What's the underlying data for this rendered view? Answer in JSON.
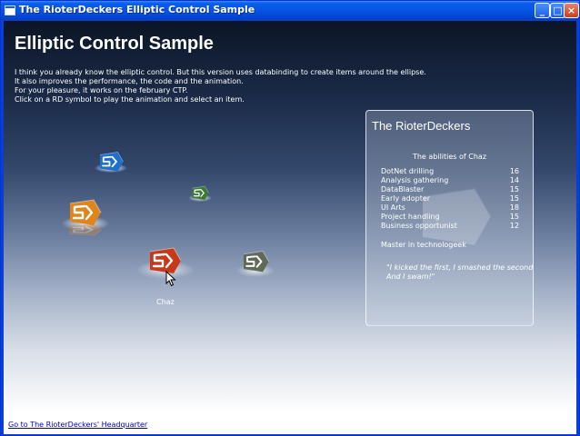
{
  "window": {
    "title": "The RioterDeckers Elliptic Control Sample",
    "controls": {
      "minimize": "_",
      "maximize": "□",
      "close": "×"
    }
  },
  "page": {
    "heading": "Elliptic Control Sample",
    "intro": [
      "I think you already know the elliptic control. But this version uses databinding to create items around the ellipse.",
      "It also improves the performance, the code and the animation.",
      "For your pleasure, it works on the february CTP.",
      "Click on a RD symbol to play the animation and select an item."
    ],
    "selected_label": "Chaz"
  },
  "colors": {
    "symbol_blue": "#1e6fd0",
    "symbol_green": "#3d7b34",
    "symbol_orange": "#e0841c",
    "symbol_red": "#c8391a",
    "symbol_gray": "#5f6a58"
  },
  "panel": {
    "title": "The RioterDeckers",
    "subtitle": "The abilities of Chaz",
    "abilities": [
      {
        "name": "DotNet drilling",
        "value": "16"
      },
      {
        "name": "Analysis gathering",
        "value": "14"
      },
      {
        "name": "DataBlaster",
        "value": "15"
      },
      {
        "name": "Early adopter",
        "value": "15"
      },
      {
        "name": "UI Arts",
        "value": "18"
      },
      {
        "name": "Project handling",
        "value": "15"
      },
      {
        "name": "Business opportunist",
        "value": "12"
      }
    ],
    "master": "Master in technologeek",
    "quote": [
      "\"I kicked the first, I smashed the second!",
      "And I swam!\""
    ]
  },
  "footer": {
    "link_text": "Go to The RioterDeckers' Headquarter"
  }
}
